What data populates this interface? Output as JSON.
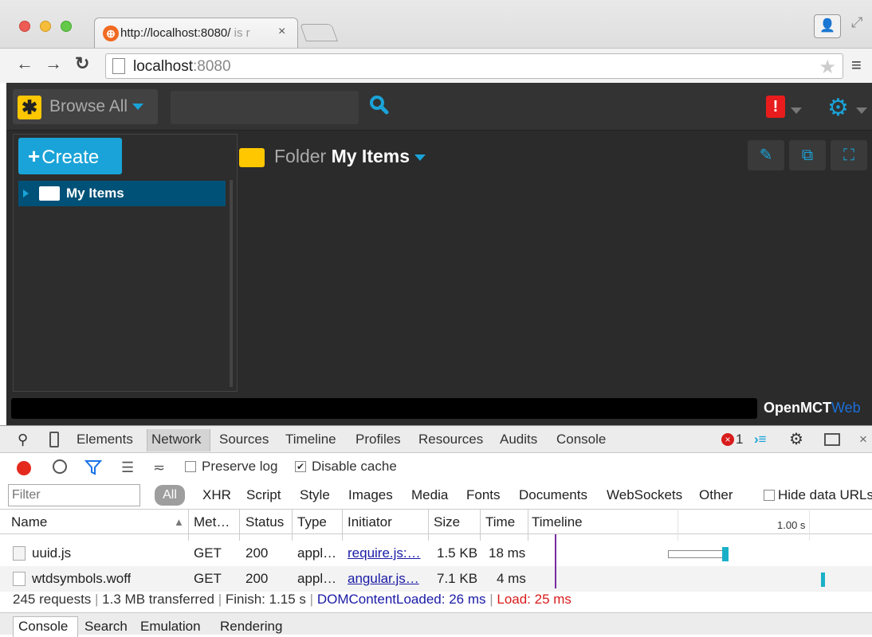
{
  "browser": {
    "tab_title": "http://localhost:8080/",
    "tab_title_fade": " is r",
    "tab_close": "×",
    "url_host": "localhost",
    "url_port": ":8080"
  },
  "app": {
    "browse_label": "Browse All",
    "search_placeholder": "",
    "create_label": "Create",
    "tree": [
      {
        "label": "My Items"
      }
    ],
    "folder_type": "Folder",
    "folder_name": "My Items",
    "alert_glyph": "!",
    "brand": "OpenMCT",
    "brand_suffix": "Web"
  },
  "devtools": {
    "tabs": [
      "Elements",
      "Network",
      "Sources",
      "Timeline",
      "Profiles",
      "Resources",
      "Audits",
      "Console"
    ],
    "active_tab": "Network",
    "error_count": "1",
    "preserve_log": "Preserve log",
    "disable_cache": "Disable cache",
    "filter_placeholder": "Filter",
    "filter_all": "All",
    "filter_types": [
      "XHR",
      "Script",
      "Style",
      "Images",
      "Media",
      "Fonts",
      "Documents",
      "WebSockets",
      "Other"
    ],
    "hide_data_urls": "Hide data URLs",
    "columns": [
      "Name",
      "Met…",
      "Status",
      "Type",
      "Initiator",
      "Size",
      "Time",
      "Timeline"
    ],
    "timeline_mark": "1.00 s",
    "rows": [
      {
        "name": "uuid.js",
        "method": "GET",
        "status": "200",
        "type": "appl…",
        "initiator": "require.js:…",
        "size": "1.5 KB",
        "time": "18 ms"
      },
      {
        "name": "wtdsymbols.woff",
        "method": "GET",
        "status": "200",
        "type": "appl…",
        "initiator": "angular.js…",
        "size": "7.1 KB",
        "time": "4 ms"
      }
    ],
    "summary": {
      "requests": "245 requests",
      "transferred": "1.3 MB transferred",
      "finish": "Finish: 1.15 s",
      "dcl": "DOMContentLoaded: 26 ms",
      "load": "Load: 25 ms"
    },
    "drawer_tabs": [
      "Console",
      "Search",
      "Emulation",
      "Rendering"
    ]
  },
  "colors": {
    "accent": "#1aa3d8",
    "alert": "#e81c1c",
    "folder": "#ffc700",
    "dcl": "#1a1aa6",
    "load": "#d81b1b"
  }
}
